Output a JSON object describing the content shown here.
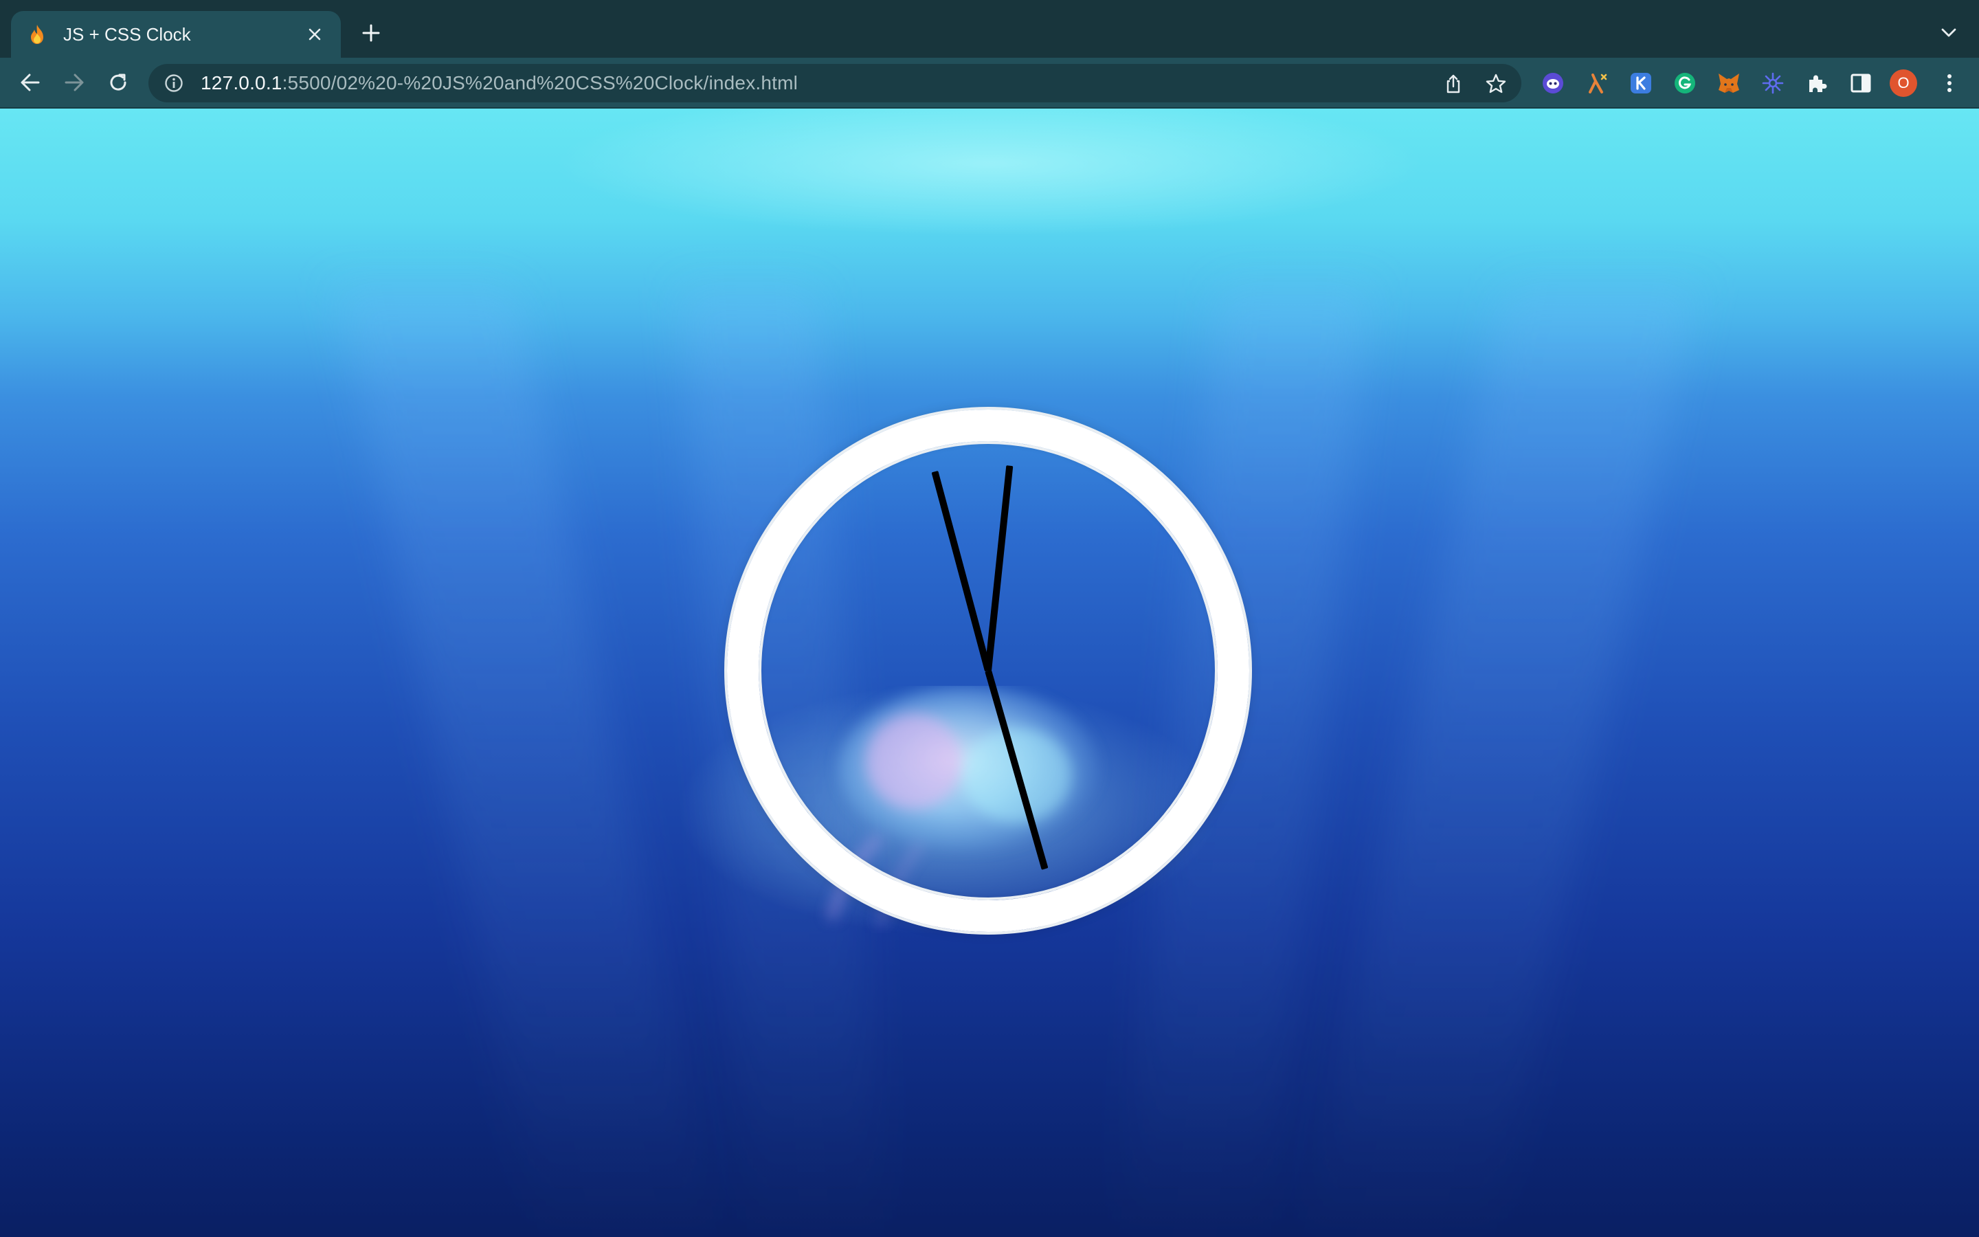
{
  "tab": {
    "title": "JS + CSS Clock",
    "favicon": "flame-icon"
  },
  "address_bar": {
    "url_host": "127.0.0.1",
    "url_path": ":5500/02%20-%20JS%20and%20CSS%20Clock/index.html"
  },
  "extensions": [
    {
      "name": "ghost-extension-icon",
      "color": "#5b4bd6"
    },
    {
      "name": "lambda-extension-icon",
      "color": "#e8833a"
    },
    {
      "name": "k-extension-icon",
      "color": "#3c7de0"
    },
    {
      "name": "grammarly-extension-icon",
      "color": "#15b57a"
    },
    {
      "name": "metamask-extension-icon",
      "color": "#e2761b"
    },
    {
      "name": "sparkle-extension-icon",
      "color": "#5f6cf0"
    }
  ],
  "profile": {
    "initial": "O",
    "color": "#e0552e"
  },
  "clock": {
    "hour_deg": 164,
    "minute_deg": -15,
    "second_deg": 6,
    "face_color": "transparent",
    "ring_color": "#ffffff",
    "hand_color": "#000000"
  }
}
